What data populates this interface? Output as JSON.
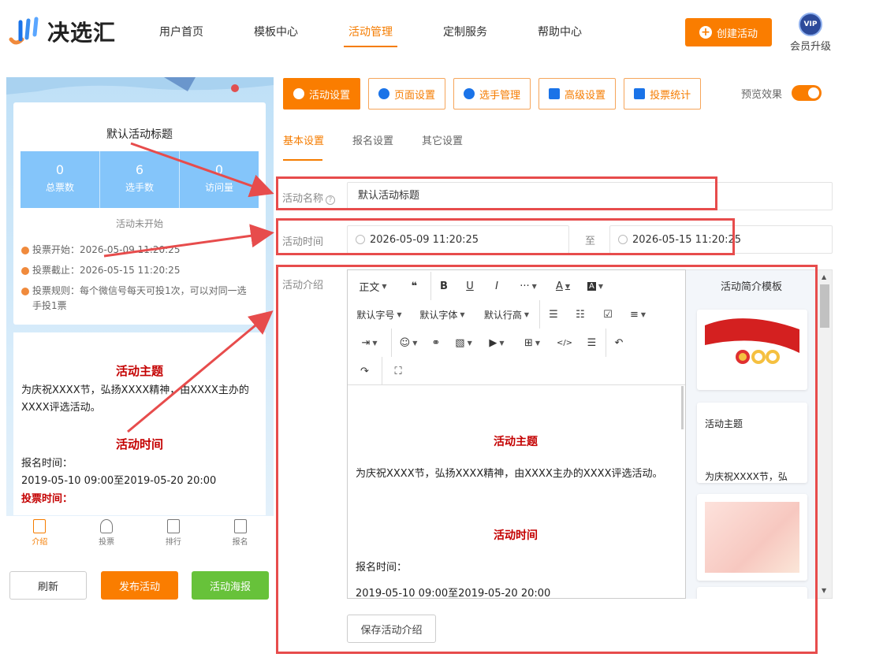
{
  "logo": {
    "text": "决选汇"
  },
  "nav": [
    {
      "label": "用户首页"
    },
    {
      "label": "模板中心"
    },
    {
      "label": "活动管理"
    },
    {
      "label": "定制服务"
    },
    {
      "label": "帮助中心"
    }
  ],
  "header": {
    "create_label": "创建活动",
    "vip_badge": "VIP",
    "vip_label": "会员升级"
  },
  "preview": {
    "title": "默认活动标题",
    "stats": [
      {
        "value": "0",
        "label": "总票数"
      },
      {
        "value": "6",
        "label": "选手数"
      },
      {
        "value": "0",
        "label": "访问量"
      }
    ],
    "status": "活动未开始",
    "vote_start": "投票开始：2026-05-09 11:20:25",
    "vote_end": "投票截止：2026-05-15 11:20:25",
    "vote_rule": "投票规则：每个微信号每天可投1次，可以对同一选手投1票",
    "content": {
      "heading1": "活动主题",
      "text1": "为庆祝XXXX节，弘扬XXXX精神，由XXXX主办的XXXX评选活动。",
      "heading2": "活动时间",
      "reg_label": "报名时间：",
      "reg_value": "2019-05-10 09:00至2019-05-20 20:00",
      "vote_label": "投票时间："
    },
    "tabbar": [
      {
        "label": "介绍"
      },
      {
        "label": "投票"
      },
      {
        "label": "排行"
      },
      {
        "label": "报名"
      }
    ]
  },
  "left_buttons": {
    "refresh": "刷新",
    "publish": "发布活动",
    "poster": "活动海报"
  },
  "tool_tabs": [
    {
      "label": "活动设置"
    },
    {
      "label": "页面设置"
    },
    {
      "label": "选手管理"
    },
    {
      "label": "高级设置"
    },
    {
      "label": "投票统计"
    }
  ],
  "preview_toggle": {
    "label": "预览效果"
  },
  "sub_tabs": [
    {
      "label": "基本设置"
    },
    {
      "label": "报名设置"
    },
    {
      "label": "其它设置"
    }
  ],
  "form": {
    "name_label": "活动名称",
    "name_value": "默认活动标题",
    "time_label": "活动时间",
    "start_time": "2026-05-09 11:20:25",
    "separator": "至",
    "end_time": "2026-05-15 11:20:25",
    "intro_label": "活动介绍"
  },
  "editor": {
    "toolbar": {
      "paragraph": "正文",
      "quote": "❝",
      "bold": "B",
      "underline": "U",
      "italic": "I",
      "more": "···",
      "font_color": "A",
      "bg_color": "A",
      "font_size": "默认字号",
      "font_family": "默认字体",
      "line_height": "默认行高"
    },
    "content": {
      "heading1": "活动主题",
      "text1": "为庆祝XXXX节，弘扬XXXX精神，由XXXX主办的XXXX评选活动。",
      "heading2": "活动时间",
      "reg_label": "报名时间：",
      "reg_value": "2019-05-10 09:00至2019-05-20 20:00"
    }
  },
  "templates": {
    "title": "活动简介模板",
    "card2_heading": "活动主题",
    "card2_text": "为庆祝XXXX节，弘"
  },
  "save_label": "保存活动介绍",
  "colors": {
    "accent": "#fa7d00",
    "highlight": "#e74c4c",
    "green": "#67c23a",
    "stats_blue": "#84c5fa",
    "heading_red": "#c40000"
  }
}
